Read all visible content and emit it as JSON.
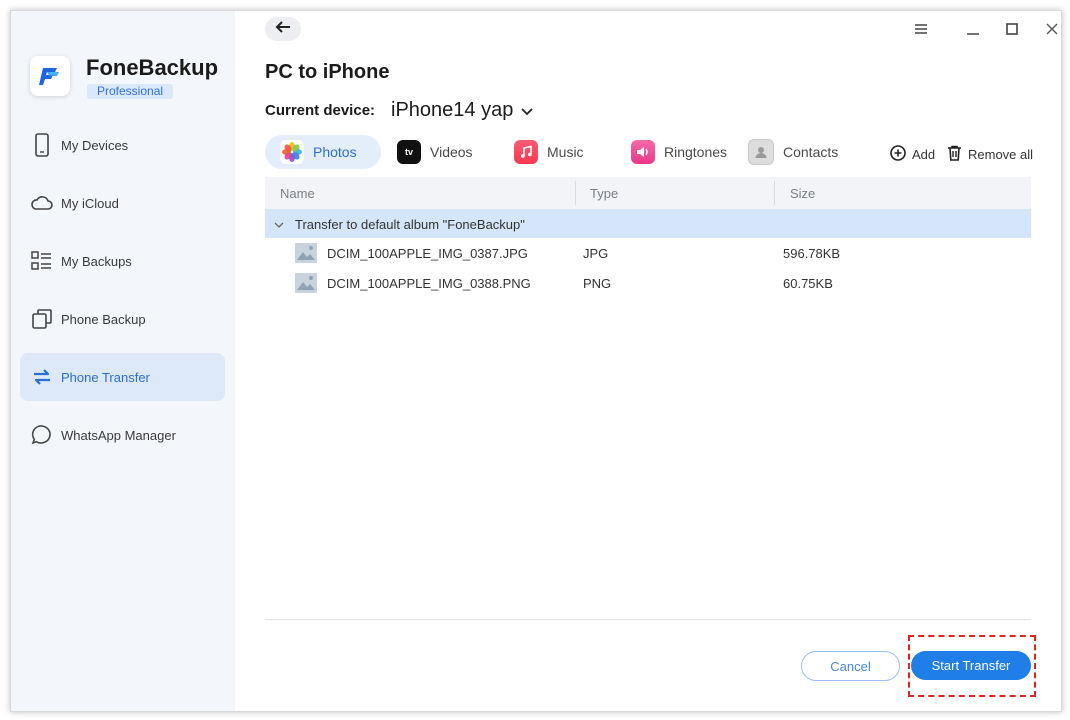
{
  "app": {
    "name": "FoneBackup",
    "edition": "Professional"
  },
  "sidebar": {
    "items": [
      {
        "label": "My Devices",
        "icon": "phone-icon",
        "active": false
      },
      {
        "label": "My iCloud",
        "icon": "cloud-icon",
        "active": false
      },
      {
        "label": "My Backups",
        "icon": "list-icon",
        "active": false
      },
      {
        "label": "Phone Backup",
        "icon": "copy-icon",
        "active": false
      },
      {
        "label": "Phone Transfer",
        "icon": "transfer-arrows-icon",
        "active": true
      },
      {
        "label": "WhatsApp Manager",
        "icon": "chat-bubble-icon",
        "active": false
      }
    ]
  },
  "page": {
    "title": "PC to iPhone",
    "device_label": "Current device:",
    "device_value": "iPhone14 yap"
  },
  "tabs": [
    {
      "label": "Photos",
      "icon": "photos-icon",
      "active": true
    },
    {
      "label": "Videos",
      "icon": "apple-tv-icon",
      "active": false
    },
    {
      "label": "Music",
      "icon": "music-icon",
      "active": false
    },
    {
      "label": "Ringtones",
      "icon": "ringtones-icon",
      "active": false
    },
    {
      "label": "Contacts",
      "icon": "contacts-icon",
      "active": false
    }
  ],
  "toolbar": {
    "add_label": "Add",
    "remove_all_label": "Remove all"
  },
  "table": {
    "columns": [
      "Name",
      "Type",
      "Size"
    ],
    "group_label": "Transfer to default album \"FoneBackup\"",
    "rows": [
      {
        "name": "DCIM_100APPLE_IMG_0387.JPG",
        "type": "JPG",
        "size": "596.78KB"
      },
      {
        "name": "DCIM_100APPLE_IMG_0388.PNG",
        "type": "PNG",
        "size": "60.75KB"
      }
    ]
  },
  "footer": {
    "cancel_label": "Cancel",
    "start_label": "Start Transfer"
  },
  "colors": {
    "accent": "#1f7ee8",
    "active_bg": "#dde9f8",
    "highlight": "#e0231f"
  }
}
